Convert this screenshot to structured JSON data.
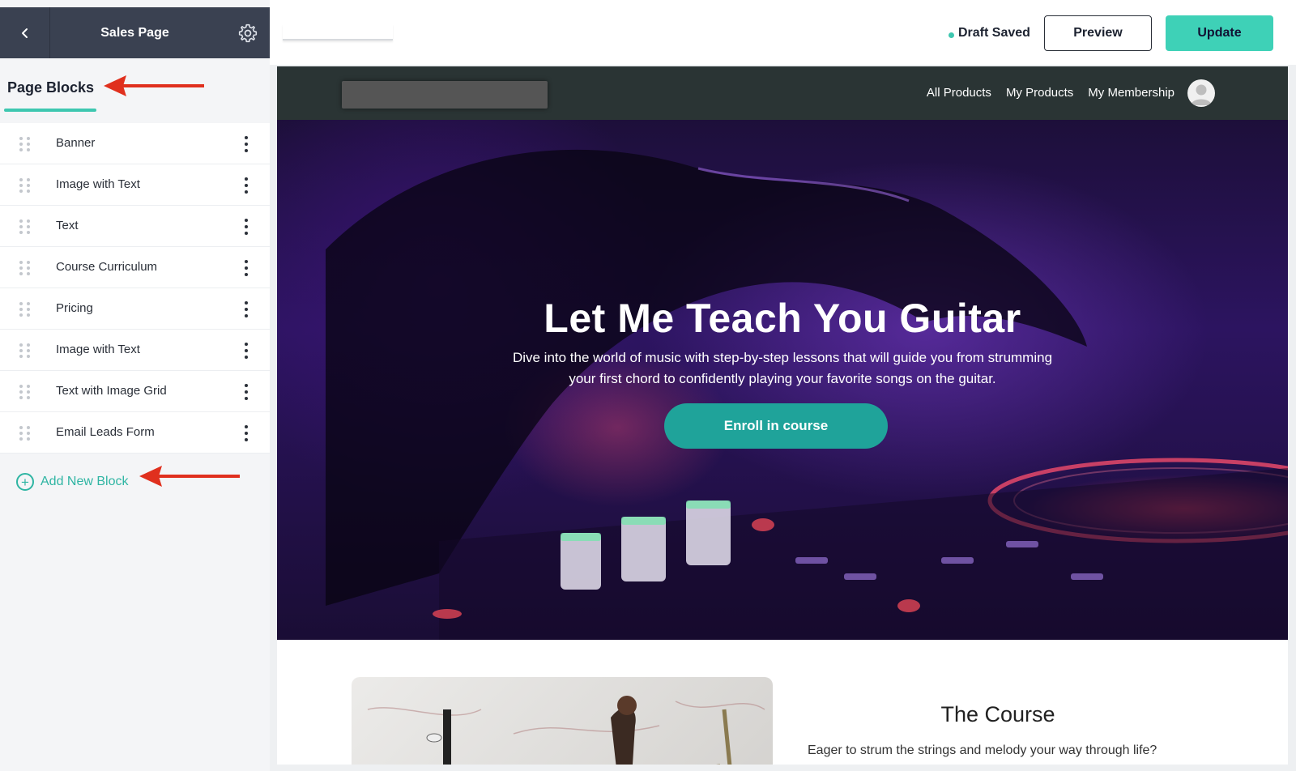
{
  "sidebar": {
    "title": "Sales Page",
    "section_title": "Page Blocks",
    "blocks": [
      {
        "label": "Banner"
      },
      {
        "label": "Image with Text"
      },
      {
        "label": "Text"
      },
      {
        "label": "Course Curriculum"
      },
      {
        "label": "Pricing"
      },
      {
        "label": "Image with Text"
      },
      {
        "label": "Text with Image Grid"
      },
      {
        "label": "Email Leads Form"
      }
    ],
    "add_block_label": "Add New Block"
  },
  "topbar": {
    "status": "Draft Saved",
    "preview_label": "Preview",
    "update_label": "Update"
  },
  "site": {
    "nav": [
      "All Products",
      "My Products",
      "My Membership"
    ],
    "hero_title": "Let Me Teach You Guitar",
    "hero_subtitle": "Dive into the world of music with step-by-step lessons that will guide you from strumming your first chord to confidently playing your favorite songs on the guitar.",
    "cta_label": "Enroll in course",
    "course_title": "The Course",
    "course_text": "Eager to strum the strings and melody your way through life?"
  },
  "colors": {
    "accent": "#3ed1b7",
    "sidebar_header": "#3a4151",
    "annotation_arrow": "#e0301e"
  }
}
